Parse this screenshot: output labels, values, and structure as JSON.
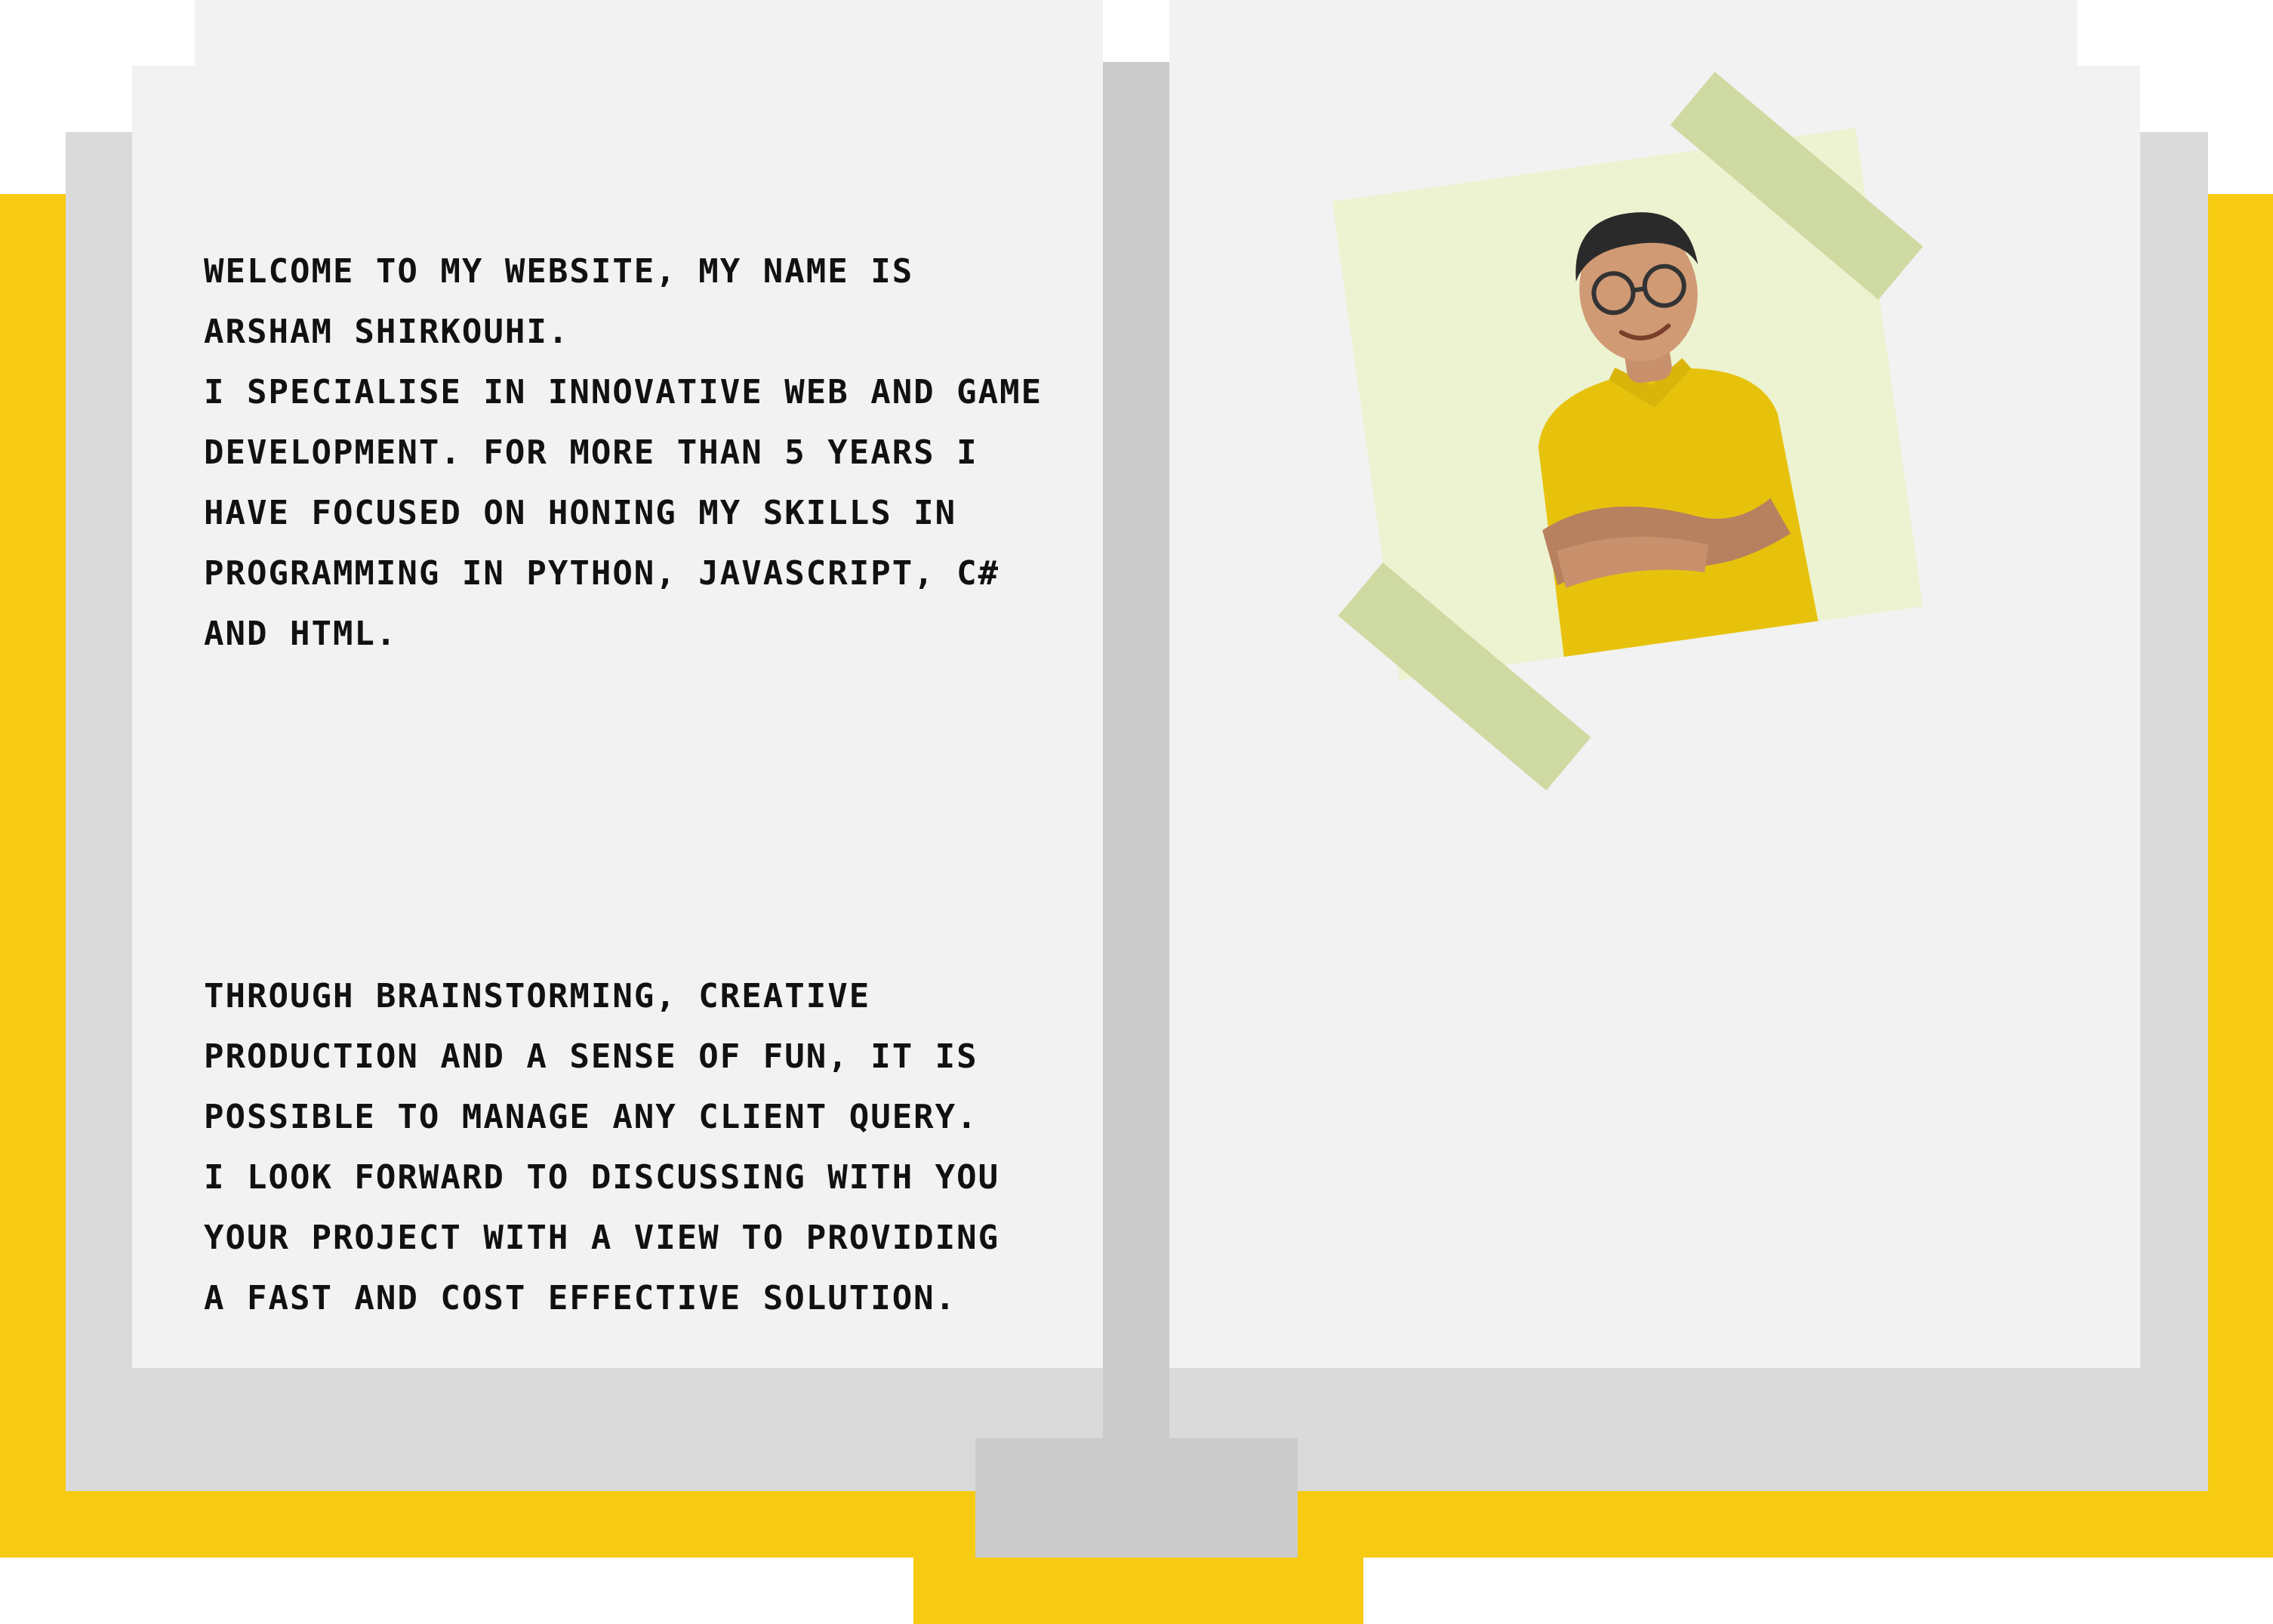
{
  "colors": {
    "cover": "#f6cb12",
    "page_shadow": "#dadada",
    "page": "#f2f2f2",
    "spine": "#cbcbcb",
    "text": "#111111",
    "photo_backing": "#edf3d0",
    "tape": "#cfdaa3",
    "shirt": "#e7c20d"
  },
  "about": {
    "paragraph_1": "WELCOME TO MY WEBSITE, MY NAME IS\nARSHAM SHIRKOUHI.\nI SPECIALISE IN INNOVATIVE WEB AND GAME\nDEVELOPMENT. FOR MORE THAN 5 YEARS I\nHAVE FOCUSED ON HONING MY SKILLS IN\nPROGRAMMING IN PYTHON, JAVASCRIPT, C#\nAND HTML.",
    "paragraph_2": "THROUGH BRAINSTORMING, CREATIVE\nPRODUCTION AND A SENSE OF FUN, IT IS\nPOSSIBLE TO MANAGE ANY CLIENT QUERY.\nI LOOK FORWARD TO DISCUSSING WITH YOU\nYOUR PROJECT WITH A VIEW TO PROVIDING\nA FAST AND COST EFFECTIVE SOLUTION."
  },
  "photo": {
    "icon": "person-portrait-icon"
  }
}
